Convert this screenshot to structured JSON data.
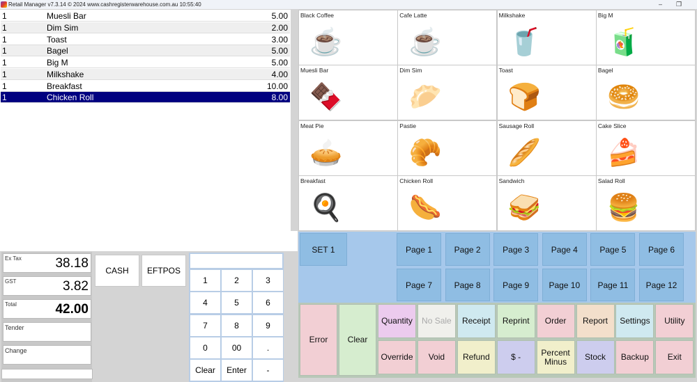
{
  "window": {
    "title": "Retail Manager v7.3.14 ©  2024 www.cashregisterwarehouse.com.au  10:55:40",
    "minimize_label": "–",
    "restore_label": "❐"
  },
  "order": {
    "items": [
      {
        "qty": "1",
        "name": "Muesli Bar",
        "price": "5.00"
      },
      {
        "qty": "1",
        "name": "Dim Sim",
        "price": "2.00"
      },
      {
        "qty": "1",
        "name": "Toast",
        "price": "3.00"
      },
      {
        "qty": "1",
        "name": "Bagel",
        "price": "5.00"
      },
      {
        "qty": "1",
        "name": "Big M",
        "price": "5.00"
      },
      {
        "qty": "1",
        "name": "Milkshake",
        "price": "4.00"
      },
      {
        "qty": "1",
        "name": "Breakfast",
        "price": "10.00"
      },
      {
        "qty": "1",
        "name": "Chicken Roll",
        "price": "8.00"
      }
    ],
    "selected_index": 7
  },
  "totals": {
    "ex_tax_label": "Ex Tax",
    "ex_tax": "38.18",
    "gst_label": "GST",
    "gst": "3.82",
    "total_label": "Total",
    "total": "42.00",
    "tender_label": "Tender",
    "tender": "",
    "change_label": "Change",
    "change": ""
  },
  "payment": {
    "cash": "CASH",
    "eftpos": "EFTPOS"
  },
  "keypad": {
    "display": "",
    "keys": [
      "1",
      "2",
      "3",
      "4",
      "5",
      "6",
      "7",
      "8",
      "9",
      "0",
      "00",
      ".",
      "Clear",
      "Enter",
      "-"
    ]
  },
  "products": [
    {
      "name": "Black Coffee",
      "icon": "coffee-cup-icon",
      "glyph": "☕"
    },
    {
      "name": "Cafe Latte",
      "icon": "latte-cup-icon",
      "glyph": "☕"
    },
    {
      "name": "Milkshake",
      "icon": "milkshake-icon",
      "glyph": "🥤"
    },
    {
      "name": "Big M",
      "icon": "milk-cartons-icon",
      "glyph": "🧃"
    },
    {
      "name": "Muesli Bar",
      "icon": "muesli-bar-icon",
      "glyph": "🍫"
    },
    {
      "name": "Dim Sim",
      "icon": "dim-sim-icon",
      "glyph": "🥟"
    },
    {
      "name": "Toast",
      "icon": "toast-icon",
      "glyph": "🍞"
    },
    {
      "name": "Bagel",
      "icon": "bagel-icon",
      "glyph": "🥯"
    },
    {
      "name": "Meat Pie",
      "icon": "meat-pie-icon",
      "glyph": "🥧"
    },
    {
      "name": "Pastie",
      "icon": "pastie-icon",
      "glyph": "🥐"
    },
    {
      "name": "Sausage Roll",
      "icon": "sausage-roll-icon",
      "glyph": "🥖"
    },
    {
      "name": "Cake Slice",
      "icon": "cake-slice-icon",
      "glyph": "🍰"
    },
    {
      "name": "Breakfast",
      "icon": "breakfast-plate-icon",
      "glyph": "🍳"
    },
    {
      "name": "Chicken Roll",
      "icon": "chicken-roll-icon",
      "glyph": "🌭"
    },
    {
      "name": "Sandwich",
      "icon": "sandwich-icon",
      "glyph": "🥪"
    },
    {
      "name": "Salad Roll",
      "icon": "salad-roll-icon",
      "glyph": "🍔"
    }
  ],
  "pages": {
    "set_label": "SET 1",
    "items": [
      "Page 1",
      "Page 2",
      "Page 3",
      "Page 4",
      "Page 5",
      "Page 6",
      "Page 7",
      "Page 8",
      "Page 9",
      "Page 10",
      "Page 11",
      "Page 12"
    ]
  },
  "functions": {
    "error": "Error",
    "clear": "Clear",
    "top": [
      {
        "label": "Quantity",
        "color": "#eccbee"
      },
      {
        "label": "No Sale",
        "color": "#f0f0ec",
        "disabled": true
      },
      {
        "label": "Receipt",
        "color": "#cfe9f0"
      },
      {
        "label": "Reprint",
        "color": "#d6edcf"
      },
      {
        "label": "Order",
        "color": "#f2cfd4"
      },
      {
        "label": "Report",
        "color": "#f3dfcb"
      },
      {
        "label": "Settings",
        "color": "#cfe9f0"
      },
      {
        "label": "Utility",
        "color": "#f2cfd4"
      }
    ],
    "bottom": [
      {
        "label": "Override",
        "color": "#f2cfd4"
      },
      {
        "label": "Void",
        "color": "#f2cfd4"
      },
      {
        "label": "Refund",
        "color": "#f1efcb"
      },
      {
        "label": "$ -",
        "color": "#cdcdee"
      },
      {
        "label": "Percent Minus",
        "color": "#f1efcb"
      },
      {
        "label": "Stock",
        "color": "#cdcdee"
      },
      {
        "label": "Backup",
        "color": "#f2cfd4"
      },
      {
        "label": "Exit",
        "color": "#f2cfd4"
      }
    ],
    "error_color": "#f2cfd4",
    "clear_color": "#d6edcf"
  }
}
